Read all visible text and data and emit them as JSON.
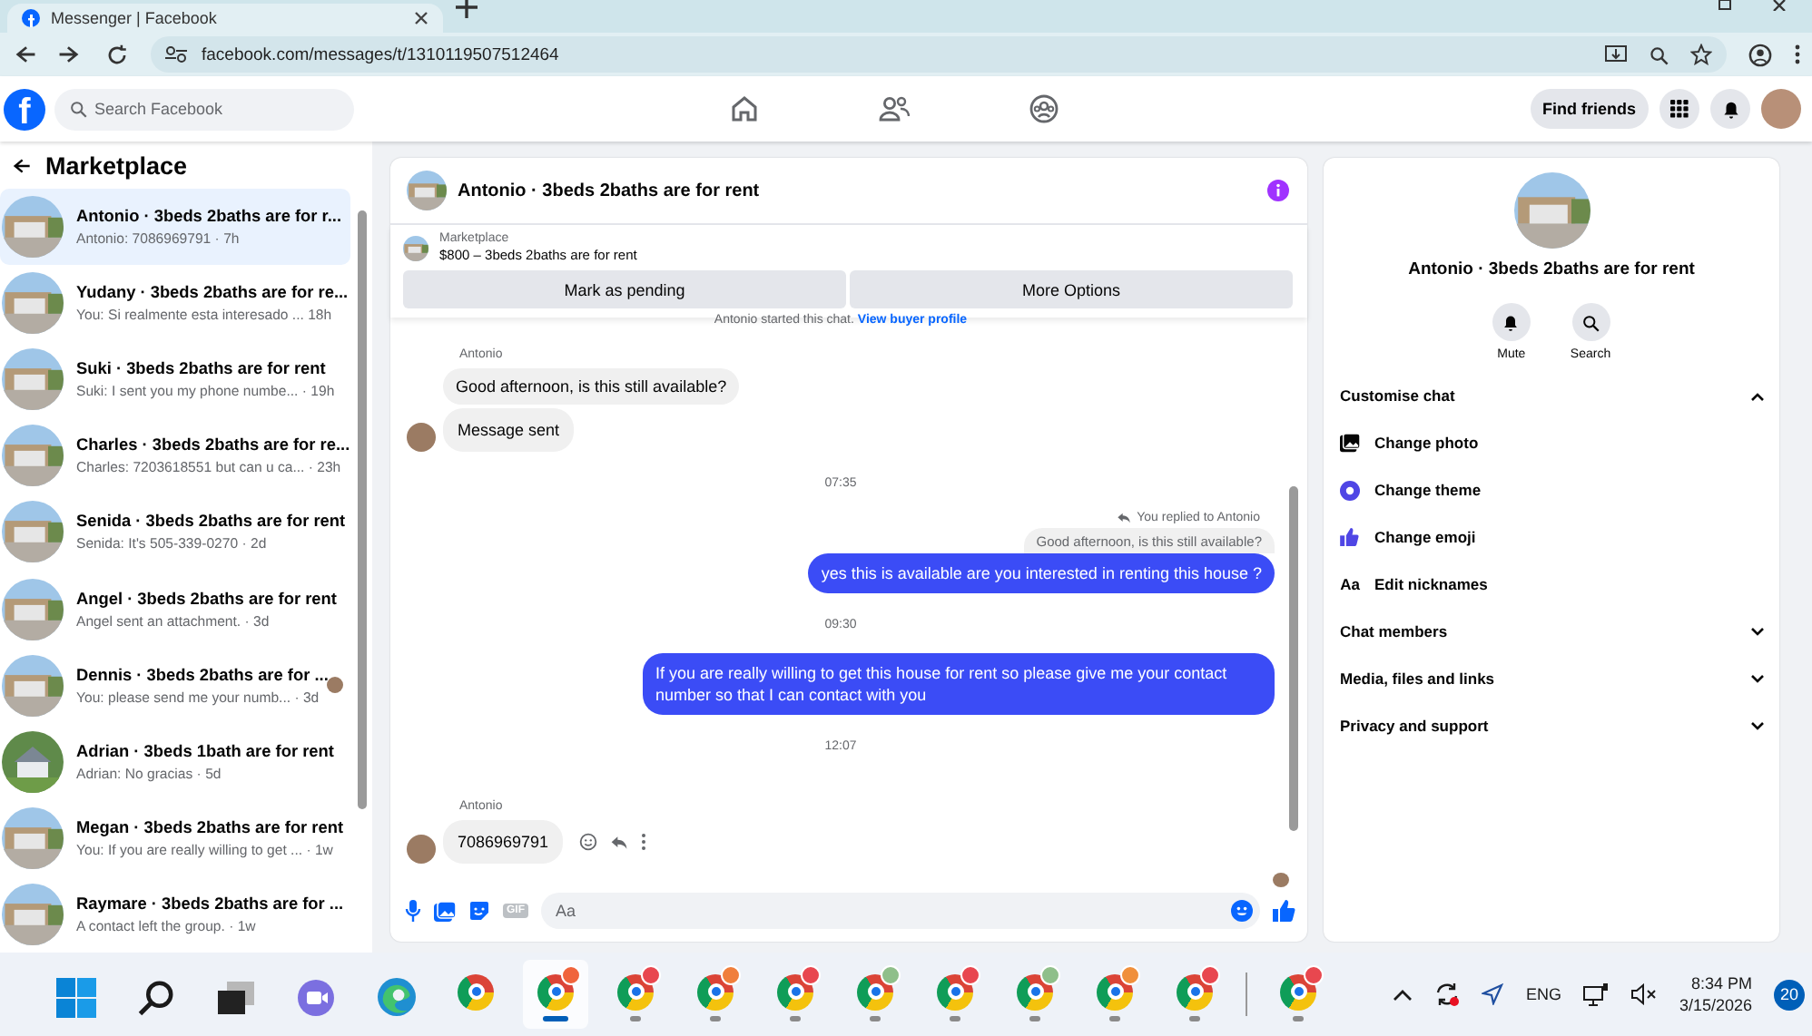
{
  "browser": {
    "tab_title": "Messenger | Facebook",
    "url": "facebook.com/messages/t/1310119507512464"
  },
  "header": {
    "logo": "f",
    "search_placeholder": "Search Facebook",
    "find_friends": "Find friends"
  },
  "sidebar": {
    "title": "Marketplace",
    "conversations": [
      {
        "title": "Antonio · 3beds 2baths are for r...",
        "preview": "Antonio: 7086969791 · 7h",
        "kind": "garage",
        "selected": true,
        "seen": false
      },
      {
        "title": "Yudany · 3beds 2baths are for re...",
        "preview": "You: Si realmente esta interesado ...  18h",
        "kind": "garage",
        "selected": false,
        "seen": false
      },
      {
        "title": "Suki · 3beds 2baths are for rent",
        "preview": "Suki: I sent you my phone numbe... · 19h",
        "kind": "garage",
        "selected": false,
        "seen": false
      },
      {
        "title": "Charles · 3beds 2baths are for re...",
        "preview": "Charles: 7203618551 but can u ca... · 23h",
        "kind": "garage",
        "selected": false,
        "seen": false
      },
      {
        "title": "Senida · 3beds 2baths are for rent",
        "preview": "Senida: It's 505-339-0270 · 2d",
        "kind": "garage",
        "selected": false,
        "seen": false
      },
      {
        "title": "Angel · 3beds 2baths are for rent",
        "preview": "Angel sent an attachment. · 3d",
        "kind": "garage",
        "selected": false,
        "seen": false
      },
      {
        "title": "Dennis · 3beds 2baths are for ...",
        "preview": "You: please send me your numb... · 3d",
        "kind": "garage",
        "selected": false,
        "seen": true
      },
      {
        "title": "Adrian · 3beds 1bath are for rent",
        "preview": "Adrian: No gracias · 5d",
        "kind": "house",
        "selected": false,
        "seen": false
      },
      {
        "title": "Megan · 3beds 2baths are for rent",
        "preview": "You: If you are really willing to get ... · 1w",
        "kind": "garage",
        "selected": false,
        "seen": false
      },
      {
        "title": "Raymare · 3beds 2baths are for ...",
        "preview": "A contact left the group. · 1w",
        "kind": "garage",
        "selected": false,
        "seen": false
      }
    ]
  },
  "chat": {
    "title": "Antonio · 3beds 2baths are for rent",
    "listing": {
      "label": "Marketplace",
      "title": "$800 – 3beds 2baths are for rent"
    },
    "buttons": [
      "Mark as pending",
      "More Options"
    ],
    "notice": {
      "text": "Antonio started this chat.",
      "link": "View buyer profile"
    },
    "messages": [
      {
        "kind": "sender",
        "text": "Antonio"
      },
      {
        "kind": "incoming",
        "text": "Good afternoon, is this still available?",
        "avatar": false,
        "actions": false
      },
      {
        "kind": "incoming",
        "text": "Message sent",
        "avatar": true,
        "actions": false
      },
      {
        "kind": "time",
        "text": "07:35"
      },
      {
        "kind": "reply_note",
        "text": "You replied to Antonio"
      },
      {
        "kind": "quoted",
        "text": "Good afternoon, is this still available?"
      },
      {
        "kind": "outgoing",
        "text": "yes this is available are you interested in renting this house ?"
      },
      {
        "kind": "time",
        "text": "09:30"
      },
      {
        "kind": "outgoing",
        "text": "If you are really willing to get this house for rent so please give me your contact number so that I  can contact with you"
      },
      {
        "kind": "time",
        "text": "12:07"
      },
      {
        "kind": "sender",
        "text": "Antonio"
      },
      {
        "kind": "incoming",
        "text": "7086969791",
        "avatar": true,
        "actions": true
      },
      {
        "kind": "seen"
      }
    ],
    "composer": {
      "gif": "GIF",
      "placeholder": "Aa"
    }
  },
  "details": {
    "title": "Antonio · 3beds 2baths are for rent",
    "actions": [
      {
        "label": "Mute",
        "kind": "mute"
      },
      {
        "label": "Search",
        "kind": "search"
      }
    ],
    "sections": [
      {
        "title": "Customise chat",
        "expanded": true,
        "items": [
          {
            "label": "Change photo",
            "kind": "photo"
          },
          {
            "label": "Change theme",
            "kind": "theme"
          },
          {
            "label": "Change emoji",
            "kind": "emoji"
          },
          {
            "label": "Edit nicknames",
            "kind": "nickname",
            "glyph": "Aa"
          }
        ]
      },
      {
        "title": "Chat members",
        "expanded": false
      },
      {
        "title": "Media, files and links",
        "expanded": false
      },
      {
        "title": "Privacy and support",
        "expanded": false
      }
    ]
  },
  "taskbar": {
    "apps": [
      {
        "kind": "start"
      },
      {
        "kind": "search"
      },
      {
        "kind": "taskview"
      },
      {
        "kind": "teams"
      },
      {
        "kind": "edge"
      },
      {
        "kind": "chrome",
        "running": false,
        "active": false
      },
      {
        "kind": "profile",
        "color": "#f0643c",
        "running": true,
        "active": true
      },
      {
        "kind": "profile",
        "color": "#e8474f",
        "running": true,
        "active": false
      },
      {
        "kind": "profile",
        "color": "#f07f3c",
        "running": true,
        "active": false
      },
      {
        "kind": "profile",
        "color": "#e8474f",
        "running": true,
        "active": false
      },
      {
        "kind": "profile",
        "color": "#8fbf8a",
        "running": true,
        "active": false
      },
      {
        "kind": "profile",
        "color": "#e8474f",
        "running": true,
        "active": false
      },
      {
        "kind": "profile",
        "color": "#8fbf8a",
        "running": true,
        "active": false
      },
      {
        "kind": "profile",
        "color": "#f0903c",
        "running": true,
        "active": false
      },
      {
        "kind": "profile",
        "color": "#e8474f",
        "running": true,
        "active": false
      },
      {
        "kind": "separator"
      },
      {
        "kind": "profile",
        "color": "#e8474f",
        "running": true,
        "active": false
      }
    ],
    "language": "ENG",
    "time": "8:34 PM",
    "date": "3/15/2026",
    "notifications": "20"
  }
}
